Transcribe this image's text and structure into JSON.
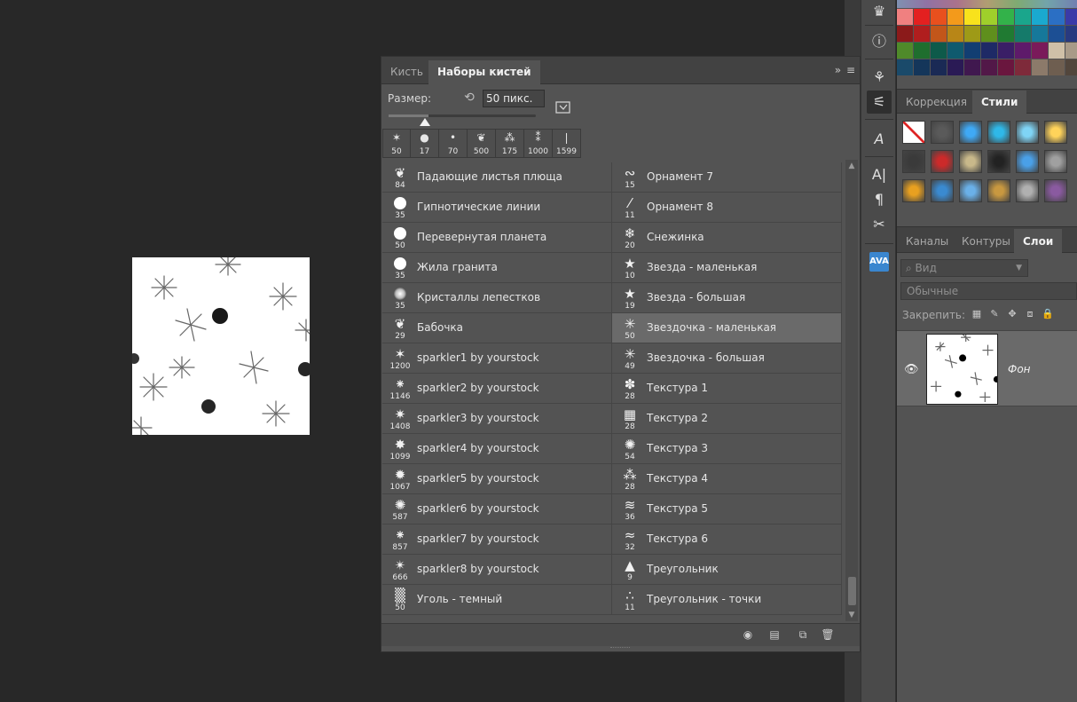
{
  "brush_panel": {
    "tabs": [
      {
        "label": "Кисть",
        "active": false
      },
      {
        "label": "Наборы кистей",
        "active": true
      }
    ],
    "menu_glyph": "»",
    "size_label": "Размер:",
    "size_value": "50 пикс.",
    "slider_fraction": 0.27,
    "recent": [
      {
        "glyph": "✶",
        "size": "50"
      },
      {
        "glyph": "●",
        "size": "17"
      },
      {
        "glyph": "•",
        "size": "70"
      },
      {
        "glyph": "❦",
        "size": "500"
      },
      {
        "glyph": "⁂",
        "size": "175"
      },
      {
        "glyph": "⁑",
        "size": "1000"
      },
      {
        "glyph": "❘",
        "size": "1599"
      }
    ],
    "presets_left": [
      {
        "name": "Падающие листья плюща",
        "size": "84",
        "icon": "leaf-icon",
        "glyph": "❦"
      },
      {
        "name": "Гипнотические линии",
        "size": "35",
        "icon": "circle-hard-icon",
        "glyph": ""
      },
      {
        "name": "Перевернутая планета",
        "size": "50",
        "icon": "circle-hard-icon",
        "glyph": ""
      },
      {
        "name": "Жила гранита",
        "size": "35",
        "icon": "circle-hard-icon",
        "glyph": ""
      },
      {
        "name": "Кристаллы лепестков",
        "size": "35",
        "icon": "circle-soft-icon",
        "glyph": ""
      },
      {
        "name": "Бабочка",
        "size": "29",
        "icon": "butterfly-icon",
        "glyph": "❦"
      },
      {
        "name": "sparkler1 by yourstock",
        "size": "1200",
        "icon": "sparkle-icon",
        "glyph": "✶"
      },
      {
        "name": "sparkler2 by yourstock",
        "size": "1146",
        "icon": "sparkle-icon",
        "glyph": "⁕"
      },
      {
        "name": "sparkler3 by yourstock",
        "size": "1408",
        "icon": "sparkle-icon",
        "glyph": "✷"
      },
      {
        "name": "sparkler4 by yourstock",
        "size": "1099",
        "icon": "sparkle-icon",
        "glyph": "✸"
      },
      {
        "name": "sparkler5 by yourstock",
        "size": "1067",
        "icon": "sparkle-icon",
        "glyph": "✹"
      },
      {
        "name": "sparkler6 by yourstock",
        "size": "587",
        "icon": "sparkle-icon",
        "glyph": "✺"
      },
      {
        "name": "sparkler7 by yourstock",
        "size": "857",
        "icon": "sparkle-icon",
        "glyph": "⁕"
      },
      {
        "name": "sparkler8 by yourstock",
        "size": "666",
        "icon": "sparkle-icon",
        "glyph": "✴"
      },
      {
        "name": "Уголь - темный",
        "size": "50",
        "icon": "charcoal-icon",
        "glyph": "▒"
      }
    ],
    "presets_right": [
      {
        "name": "Орнамент 7",
        "size": "15",
        "icon": "ornament-icon",
        "glyph": "∾",
        "selected": false
      },
      {
        "name": "Орнамент 8",
        "size": "11",
        "icon": "ornament-icon",
        "glyph": "⁄",
        "selected": false
      },
      {
        "name": "Снежинка",
        "size": "20",
        "icon": "snowflake-icon",
        "glyph": "❄",
        "selected": false
      },
      {
        "name": "Звезда - маленькая",
        "size": "10",
        "icon": "star-icon",
        "glyph": "★",
        "selected": false
      },
      {
        "name": "Звезда - большая",
        "size": "19",
        "icon": "star-icon",
        "glyph": "★",
        "selected": false
      },
      {
        "name": "Звездочка - маленькая",
        "size": "50",
        "icon": "asterisk-icon",
        "glyph": "✳",
        "selected": true
      },
      {
        "name": "Звездочка - большая",
        "size": "49",
        "icon": "asterisk-icon",
        "glyph": "✳",
        "selected": false
      },
      {
        "name": "Текстура 1",
        "size": "28",
        "icon": "texture-icon",
        "glyph": "✽",
        "selected": false
      },
      {
        "name": "Текстура 2",
        "size": "28",
        "icon": "texture-icon",
        "glyph": "▦",
        "selected": false
      },
      {
        "name": "Текстура 3",
        "size": "54",
        "icon": "texture-icon",
        "glyph": "✺",
        "selected": false
      },
      {
        "name": "Текстура 4",
        "size": "28",
        "icon": "texture-icon",
        "glyph": "⁂",
        "selected": false
      },
      {
        "name": "Текстура 5",
        "size": "36",
        "icon": "texture-icon",
        "glyph": "≋",
        "selected": false
      },
      {
        "name": "Текстура 6",
        "size": "32",
        "icon": "texture-icon",
        "glyph": "≈",
        "selected": false
      },
      {
        "name": "Треугольник",
        "size": "9",
        "icon": "triangle-icon",
        "glyph": "▲",
        "selected": false
      },
      {
        "name": "Треугольник - точки",
        "size": "11",
        "icon": "triangle-dots-icon",
        "glyph": "∴",
        "selected": false
      }
    ]
  },
  "right_panels": {
    "adjust_tabs": [
      {
        "label": "Коррекция",
        "active": false
      },
      {
        "label": "Стили",
        "active": true
      }
    ],
    "layers_tabs": [
      {
        "label": "Каналы",
        "active": false
      },
      {
        "label": "Контуры",
        "active": false
      },
      {
        "label": "Слои",
        "active": true
      }
    ],
    "filter_placeholder": "Вид",
    "blend_mode": "Обычные",
    "lock_label": "Закрепить:",
    "layer_name": "Фон",
    "ava_label": "AVA"
  },
  "colors": {
    "swatches": [
      "#f08080",
      "#e32020",
      "#e8501e",
      "#f39a1b",
      "#f8e21c",
      "#9fcf2b",
      "#33b24a",
      "#1aa68c",
      "#1aa9cf",
      "#2b6fc4",
      "#3a3aa8",
      "#8b1a1a",
      "#b01e1e",
      "#c2561a",
      "#b88617",
      "#9e9a17",
      "#5f8f1d",
      "#207a32",
      "#157a6a",
      "#16789a",
      "#1c4f94",
      "#283a80",
      "#4f8a2a",
      "#1f6e2e",
      "#0e5a4a",
      "#0f5a6e",
      "#123e72",
      "#1e2a66",
      "#3a1e66",
      "#5e1a6a",
      "#7a1a5a",
      "#cfc0a8",
      "#a89a88",
      "#1a4a6a",
      "#14365a",
      "#1a2a55",
      "#2a1a55",
      "#40184f",
      "#521848",
      "#6a163e",
      "#7e2a3a",
      "#8c7a6a",
      "#6e5e50",
      "#52463c"
    ],
    "styles": [
      "#ffffff",
      "#5a5a5a",
      "#3fa9f5",
      "#2fb8e8",
      "#7fd4f5",
      "#ffd35a",
      "#3a3a3a",
      "#cc2a2a",
      "#c8b88a",
      "#222222",
      "#4aa0e8",
      "#a0a0a0",
      "#e8a020",
      "#3a8ad0",
      "#6ab0e8",
      "#c89840",
      "#b0b0b0",
      "#8a5aa0"
    ]
  }
}
